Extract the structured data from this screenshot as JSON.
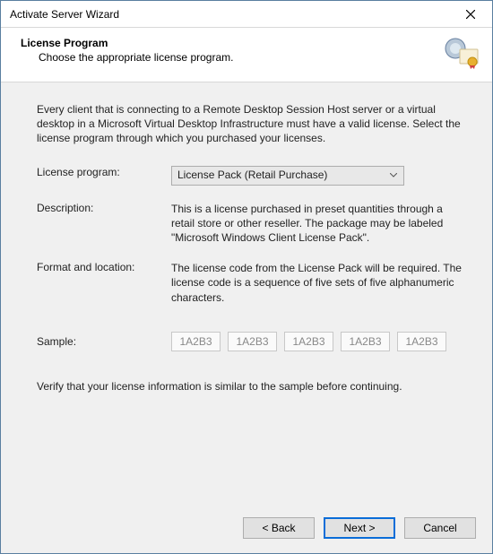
{
  "window": {
    "title": "Activate Server Wizard"
  },
  "header": {
    "title": "License Program",
    "subtitle": "Choose the appropriate license program."
  },
  "content": {
    "intro": "Every client that is connecting to a Remote Desktop Session Host server or a virtual desktop in a Microsoft Virtual Desktop Infrastructure must have a valid license. Select the license program through which you purchased your licenses.",
    "labels": {
      "license_program": "License program:",
      "description": "Description:",
      "format_location": "Format and location:",
      "sample": "Sample:"
    },
    "license_program_value": "License Pack (Retail Purchase)",
    "description_value": "This is a license purchased in preset quantities through a retail store or other reseller. The package may be labeled \"Microsoft Windows Client License Pack\".",
    "format_value": "The license code from the License Pack will be required. The license code is a sequence of five sets of five alphanumeric characters.",
    "sample_values": [
      "1A2B3",
      "1A2B3",
      "1A2B3",
      "1A2B3",
      "1A2B3"
    ],
    "verify": "Verify that your license information is similar to the sample before continuing."
  },
  "footer": {
    "back": "< Back",
    "next": "Next >",
    "cancel": "Cancel"
  }
}
